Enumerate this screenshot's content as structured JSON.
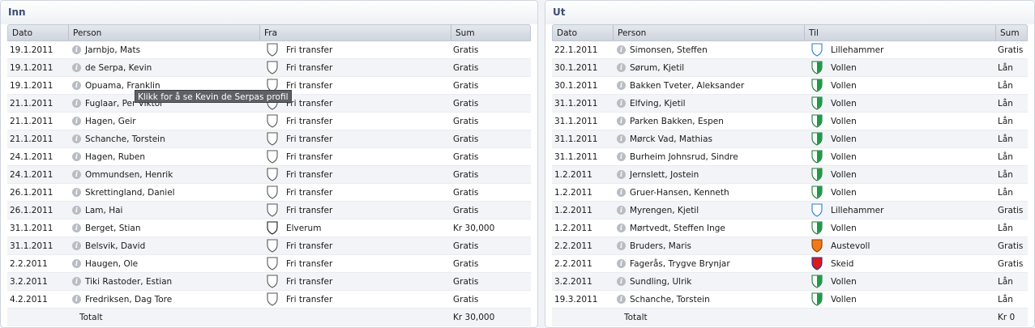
{
  "in_panel": {
    "title": "Inn",
    "headers": {
      "date": "Dato",
      "person": "Person",
      "from": "Fra",
      "sum": "Sum"
    },
    "rows": [
      {
        "date": "19.1.2011",
        "person": "Jarnbjo, Mats",
        "club": "Fri transfer",
        "crest": "white",
        "sum": "Gratis"
      },
      {
        "date": "19.1.2011",
        "person": "de Serpa, Kevin",
        "club": "Fri transfer",
        "crest": "white",
        "sum": "Gratis"
      },
      {
        "date": "19.1.2011",
        "person": "Opuama, Franklin",
        "club": "Fri transfer",
        "crest": "white",
        "sum": "Gratis"
      },
      {
        "date": "21.1.2011",
        "person": "Fuglaar, Per Viktor",
        "club": "Fri transfer",
        "crest": "white",
        "sum": "Gratis"
      },
      {
        "date": "21.1.2011",
        "person": "Hagen, Geir",
        "club": "Fri transfer",
        "crest": "white",
        "sum": "Gratis"
      },
      {
        "date": "21.1.2011",
        "person": "Schanche, Torstein",
        "club": "Fri transfer",
        "crest": "white",
        "sum": "Gratis"
      },
      {
        "date": "24.1.2011",
        "person": "Hagen, Ruben",
        "club": "Fri transfer",
        "crest": "white",
        "sum": "Gratis"
      },
      {
        "date": "24.1.2011",
        "person": "Ommundsen, Henrik",
        "club": "Fri transfer",
        "crest": "white",
        "sum": "Gratis"
      },
      {
        "date": "26.1.2011",
        "person": "Skrettingland, Daniel",
        "club": "Fri transfer",
        "crest": "white",
        "sum": "Gratis"
      },
      {
        "date": "26.1.2011",
        "person": "Lam, Hai",
        "club": "Fri transfer",
        "crest": "white",
        "sum": "Gratis"
      },
      {
        "date": "31.1.2011",
        "person": "Berget, Stian",
        "club": "Elverum",
        "crest": "white-dark",
        "sum": "Kr 30,000"
      },
      {
        "date": "31.1.2011",
        "person": "Belsvik, David",
        "club": "Fri transfer",
        "crest": "white",
        "sum": "Gratis"
      },
      {
        "date": "2.2.2011",
        "person": "Haugen, Ole",
        "club": "Fri transfer",
        "crest": "white",
        "sum": "Gratis"
      },
      {
        "date": "3.2.2011",
        "person": "Tiki Rastoder, Estian",
        "club": "Fri transfer",
        "crest": "white",
        "sum": "Gratis"
      },
      {
        "date": "4.2.2011",
        "person": "Fredriksen, Dag Tore",
        "club": "Fri transfer",
        "crest": "white",
        "sum": "Gratis"
      }
    ],
    "total_label": "Totalt",
    "total_sum": "Kr 30,000",
    "tooltip": "Klikk for å se Kevin de Serpas profil"
  },
  "out_panel": {
    "title": "Ut",
    "headers": {
      "date": "Dato",
      "person": "Person",
      "to": "Til",
      "sum": "Sum"
    },
    "rows": [
      {
        "date": "22.1.2011",
        "person": "Simonsen, Steffen",
        "club": "Lillehammer",
        "crest": "blue-white",
        "sum": "Gratis"
      },
      {
        "date": "30.1.2011",
        "person": "Sørum, Kjetil",
        "club": "Vollen",
        "crest": "green",
        "sum": "Lån"
      },
      {
        "date": "30.1.2011",
        "person": "Bakken Tveter, Aleksander",
        "club": "Vollen",
        "crest": "green",
        "sum": "Lån"
      },
      {
        "date": "31.1.2011",
        "person": "Elfving, Kjetil",
        "club": "Vollen",
        "crest": "green",
        "sum": "Lån"
      },
      {
        "date": "31.1.2011",
        "person": "Parken Bakken, Espen",
        "club": "Vollen",
        "crest": "green",
        "sum": "Lån"
      },
      {
        "date": "31.1.2011",
        "person": "Mørck Vad, Mathias",
        "club": "Vollen",
        "crest": "green",
        "sum": "Lån"
      },
      {
        "date": "31.1.2011",
        "person": "Burheim Johnsrud, Sindre",
        "club": "Vollen",
        "crest": "green",
        "sum": "Lån"
      },
      {
        "date": "1.2.2011",
        "person": "Jernslett, Jostein",
        "club": "Vollen",
        "crest": "green",
        "sum": "Lån"
      },
      {
        "date": "1.2.2011",
        "person": "Gruer-Hansen, Kenneth",
        "club": "Vollen",
        "crest": "green",
        "sum": "Lån"
      },
      {
        "date": "1.2.2011",
        "person": "Myrengen, Kjetil",
        "club": "Lillehammer",
        "crest": "blue-white",
        "sum": "Gratis"
      },
      {
        "date": "1.2.2011",
        "person": "Mørtvedt, Steffen Inge",
        "club": "Vollen",
        "crest": "green",
        "sum": "Lån"
      },
      {
        "date": "2.2.2011",
        "person": "Bruders, Maris",
        "club": "Austevoll",
        "crest": "orange",
        "sum": "Gratis"
      },
      {
        "date": "2.2.2011",
        "person": "Fagerås, Trygve Brynjar",
        "club": "Skeid",
        "crest": "red",
        "sum": "Gratis"
      },
      {
        "date": "3.2.2011",
        "person": "Sundling, Ulrik",
        "club": "Vollen",
        "crest": "green",
        "sum": "Lån"
      },
      {
        "date": "19.3.2011",
        "person": "Schanche, Torstein",
        "club": "Vollen",
        "crest": "green",
        "sum": "Lån"
      }
    ],
    "total_label": "Totalt",
    "total_sum": "Kr 0"
  },
  "crest_colors": {
    "white": {
      "fill": "#ffffff",
      "stroke": "#5a5a5a",
      "inner": "#ffffff"
    },
    "white-dark": {
      "fill": "#ffffff",
      "stroke": "#1a1a1a",
      "inner": "#ffffff"
    },
    "blue-white": {
      "fill": "#ffffff",
      "stroke": "#2b7fd0",
      "inner": "#ffffff"
    },
    "green": {
      "fill": "#ffffff",
      "stroke": "#1b7b3a",
      "inner": "#1f9a48"
    },
    "orange": {
      "fill": "#f07a1a",
      "stroke": "#8a3d00",
      "inner": "#f07a1a"
    },
    "red": {
      "fill": "#d91a20",
      "stroke": "#24309a",
      "inner": "#d91a20"
    }
  }
}
